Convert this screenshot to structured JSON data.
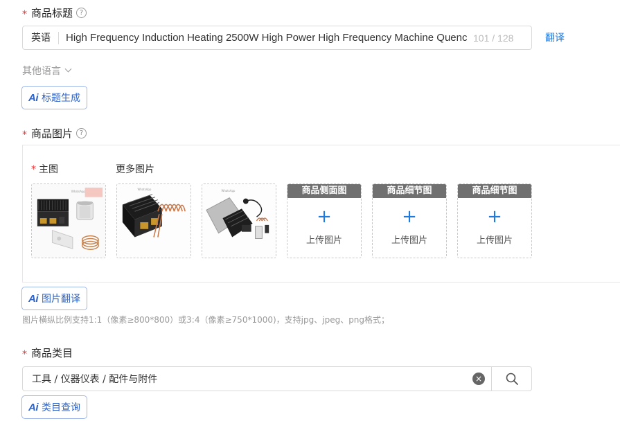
{
  "title_section": {
    "label": "商品标题",
    "help": "?",
    "language": "英语",
    "value": "High Frequency Induction Heating 2500W High Power High Frequency Machine Quenc",
    "counter": "101 / 128",
    "translate_link": "翻译",
    "other_languages": "其他语言",
    "ai_button": "标题生成"
  },
  "image_section": {
    "label": "商品图片",
    "help": "?",
    "main_label": "主图",
    "more_label": "更多图片",
    "upload_slots": [
      {
        "header": "商品侧面图",
        "action": "上传图片"
      },
      {
        "header": "商品细节图",
        "action": "上传图片"
      },
      {
        "header": "商品细节图",
        "action": "上传图片"
      }
    ],
    "ai_button": "图片翻译",
    "hint": "图片横纵比例支持1:1（像素≥800*800）或3:4（像素≥750*1000)，支持jpg、jpeg、png格式；"
  },
  "category_section": {
    "label": "商品类目",
    "value": "工具 / 仪器仪表 / 配件与附件",
    "clear_icon": "×",
    "ai_button": "类目查询"
  },
  "ai_mark": "Ai",
  "required_mark": "*",
  "plus": "+",
  "accent_color": "#1f7adf",
  "required_color": "#e4393c"
}
